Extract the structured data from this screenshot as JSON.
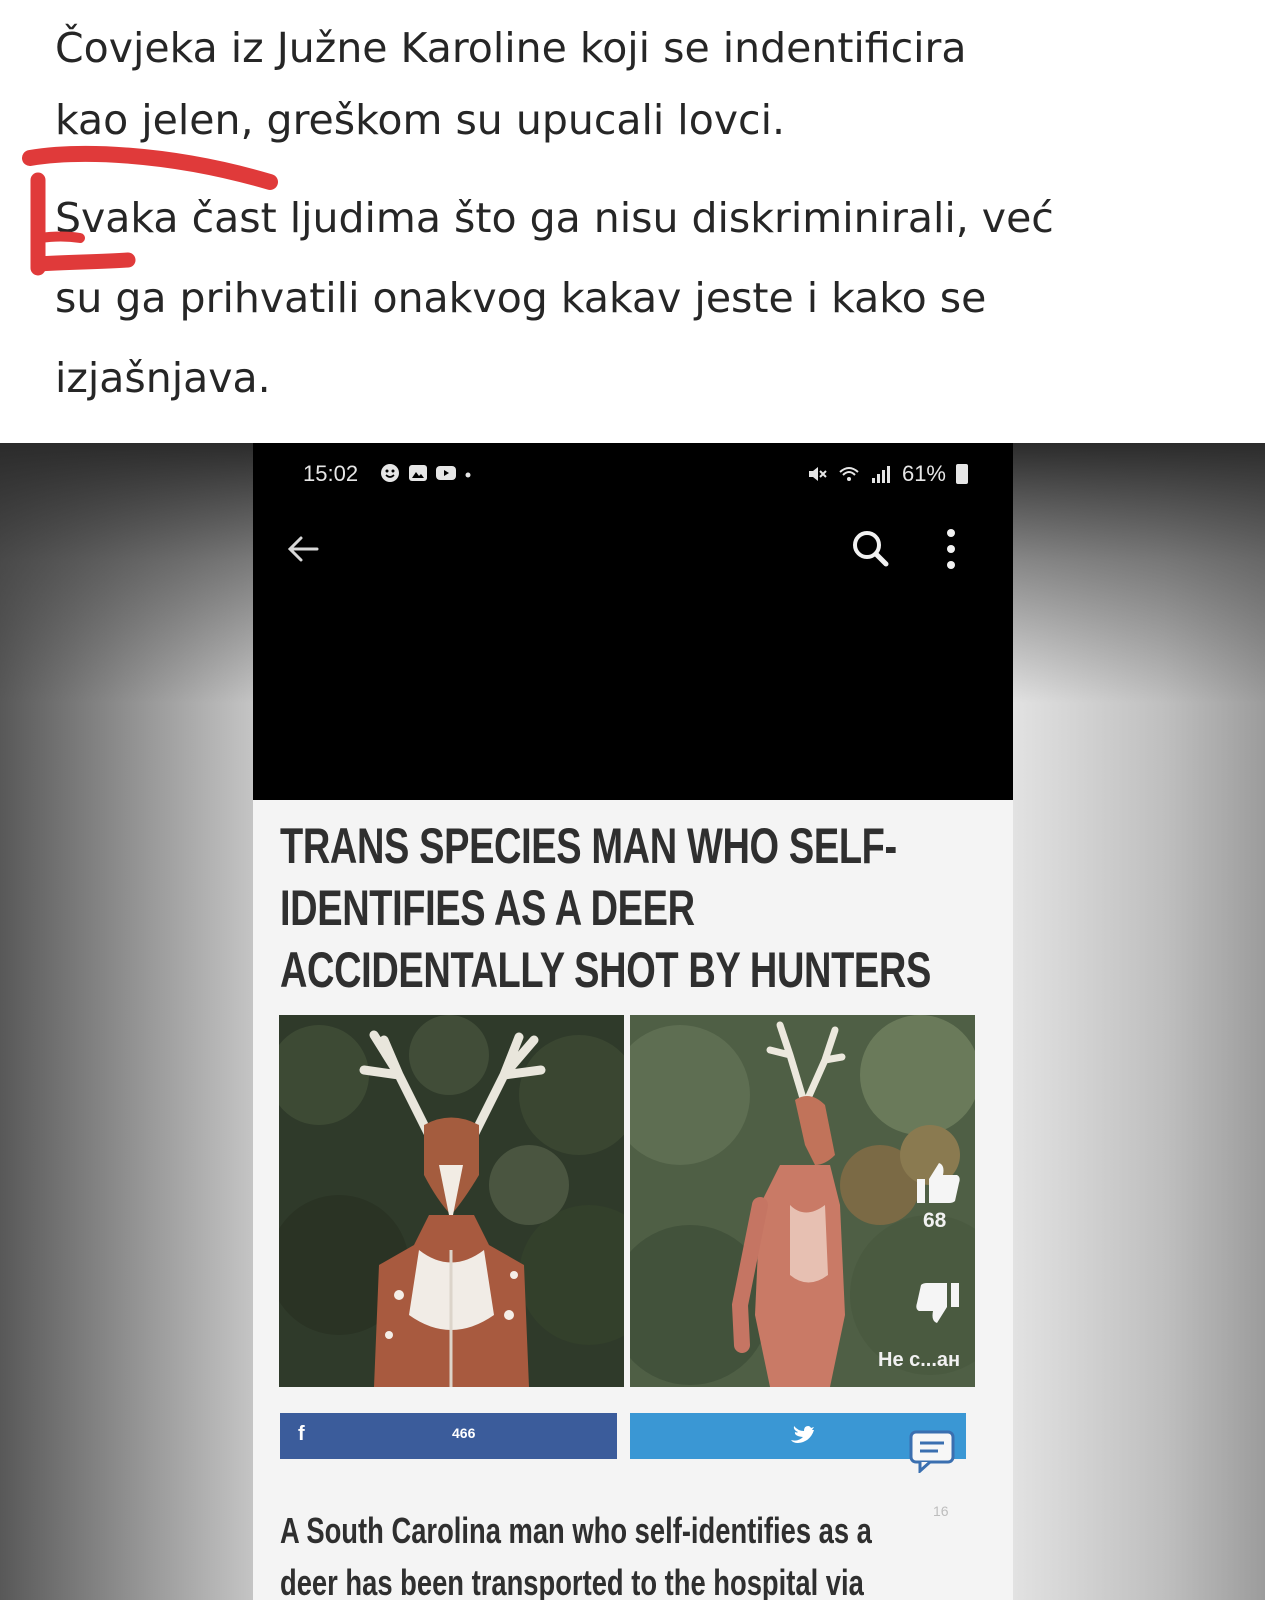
{
  "caption": {
    "line1": "Čovjeka iz Južne Karoline koji se indentificira",
    "line2": "kao jelen, greškom su upucali lovci.",
    "line3": "Svaka čast ljudima što ga nisu diskriminirali, već",
    "line4": "su ga prihvatili onakvog kakav jeste i kako se",
    "line5": "izjašnjava.",
    "annotation_color": "#e03a3a"
  },
  "phone": {
    "status": {
      "time": "15:02",
      "battery": "61%",
      "icons_left": [
        "face-icon",
        "image-icon",
        "youtube-icon",
        "dot-icon"
      ],
      "icons_right": [
        "mute-icon",
        "wifi-icon",
        "signal-icon",
        "battery-icon"
      ]
    },
    "app_bar": {
      "icons": [
        "back-arrow-icon",
        "search-icon",
        "more-vertical-icon"
      ]
    },
    "article": {
      "headline_line1": "TRANS SPECIES MAN WHO SELF-",
      "headline_line2": "IDENTIFIES AS A DEER",
      "headline_line3": "ACCIDENTALLY SHOT BY HUNTERS",
      "like_count": "68",
      "dislike_label": "Не с...ан",
      "share": {
        "facebook_icon": "f",
        "facebook_count": "466",
        "facebook_color": "#3b5c9b",
        "twitter_color": "#3a97d4"
      },
      "body_line1": "A South Carolina man who self-identifies as a",
      "body_line2": "deer has been transported to the hospital via",
      "overlay_badge": "16"
    }
  }
}
